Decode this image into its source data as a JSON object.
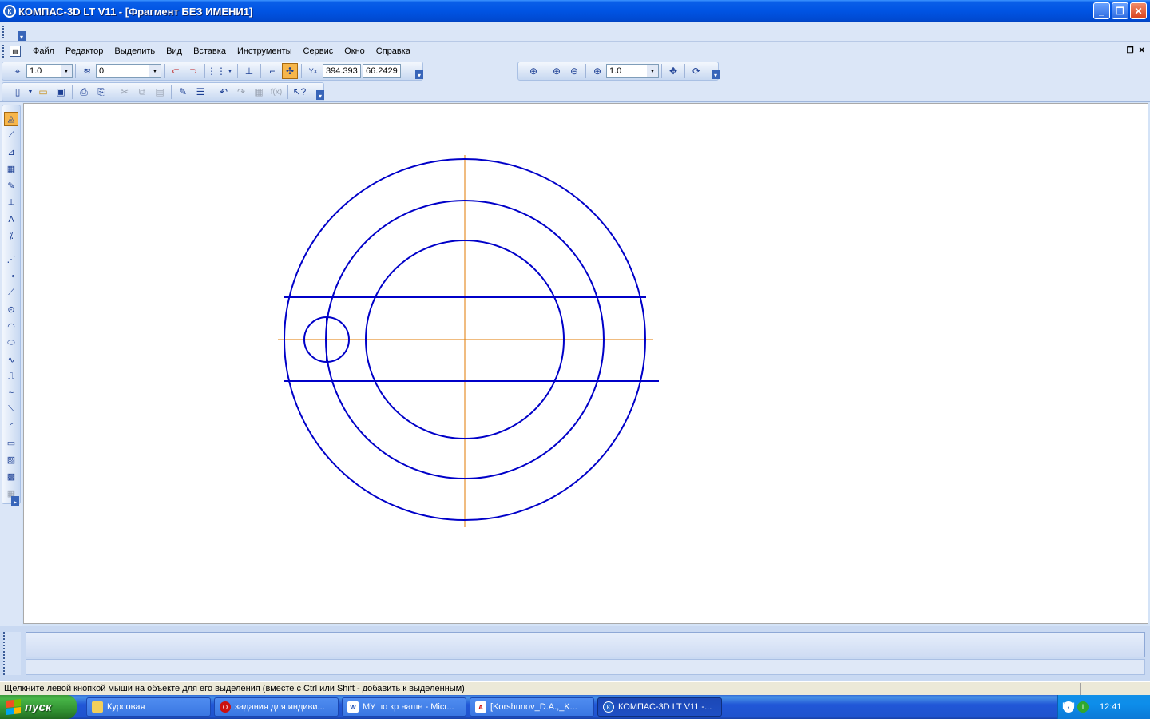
{
  "window": {
    "app_logo": "К",
    "title": "КОМПАС-3D LT V11 - [Фрагмент БЕЗ ИМЕНИ1]",
    "minimize": "_",
    "restore": "❐",
    "close": "✕"
  },
  "menu": {
    "items": [
      "Файл",
      "Редактор",
      "Выделить",
      "Вид",
      "Вставка",
      "Инструменты",
      "Сервис",
      "Окно",
      "Справка"
    ],
    "mdi_minimize": "_",
    "mdi_restore": "❐",
    "mdi_close": "✕"
  },
  "current_params": {
    "step_value": "1.0",
    "layer_value": "0",
    "coord_x": "394.393",
    "coord_y": "66.2429"
  },
  "view_toolbar": {
    "zoom_value": "1.0"
  },
  "status": {
    "hint": "Щелкните левой кнопкой мыши на объекте для его выделения (вместе с Ctrl или Shift - добавить к выделенным)"
  },
  "taskbar": {
    "start_label": "пуск",
    "tasks": [
      {
        "label": "Курсовая",
        "icon": "folder-icon"
      },
      {
        "label": "задания для индиви...",
        "icon": "opera-icon"
      },
      {
        "label": "МУ по кр наше - Micr...",
        "icon": "word-icon"
      },
      {
        "label": "[Korshunov_D.A.,_K...",
        "icon": "pdf-icon"
      },
      {
        "label": "КОМПАС-3D LT V11 -...",
        "icon": "kompas-icon"
      }
    ],
    "lang": "RU",
    "clock": "12:41"
  },
  "drawing": {
    "main_line_color": "#0000c8",
    "axis_line_color": "#e07a00"
  }
}
